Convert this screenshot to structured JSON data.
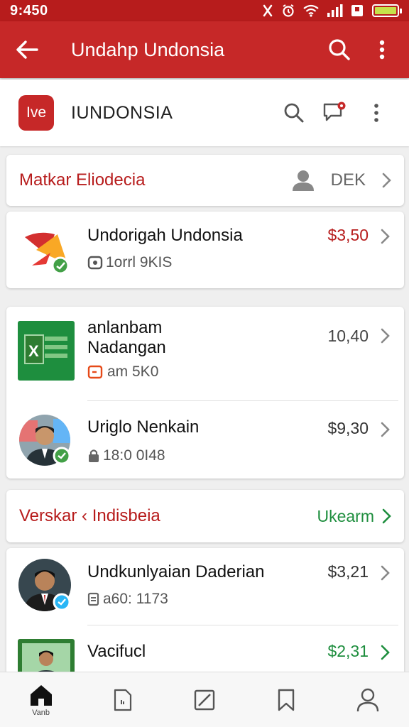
{
  "status_bar": {
    "time": "9:450"
  },
  "app_bar": {
    "title": "Undahp Undonsia"
  },
  "profile": {
    "logo_text": "Ive",
    "name": "IUNDONSIA"
  },
  "section1": {
    "title": "Matkar Eliodecia",
    "action": "DEK"
  },
  "items1": [
    {
      "title": "Undorigah Undonsia",
      "sub": "1orrl 9KIS",
      "price": "$3,50",
      "price_color": "#b71c1c"
    },
    {
      "title_line1": "anlanbam",
      "title_line2": "Nadangan",
      "sub": "am 5K0",
      "price": "10,40",
      "price_color": "#444444"
    },
    {
      "title": "Uriglo Nenkain",
      "sub": "18:0 0I48",
      "price": "$9,30",
      "price_color": "#333333"
    }
  ],
  "section2": {
    "title": "Verskar ‹ Indisbeia",
    "action": "Ukearm",
    "action_color": "#1e8e3e"
  },
  "items2": [
    {
      "title": "Undkunlyaian Daderian",
      "sub": "a60:  1173",
      "price": "$3,21",
      "price_color": "#333333"
    },
    {
      "title": "Vacifucl",
      "price": "$2,31",
      "price_color": "#1e8e3e"
    }
  ],
  "bottom_nav": {
    "home_label": "Vanb",
    "items": [
      "home-icon",
      "document-icon",
      "edit-icon",
      "bookmark-icon",
      "profile-icon"
    ]
  },
  "colors": {
    "primary": "#c62828",
    "accent_green": "#1e8e3e"
  }
}
